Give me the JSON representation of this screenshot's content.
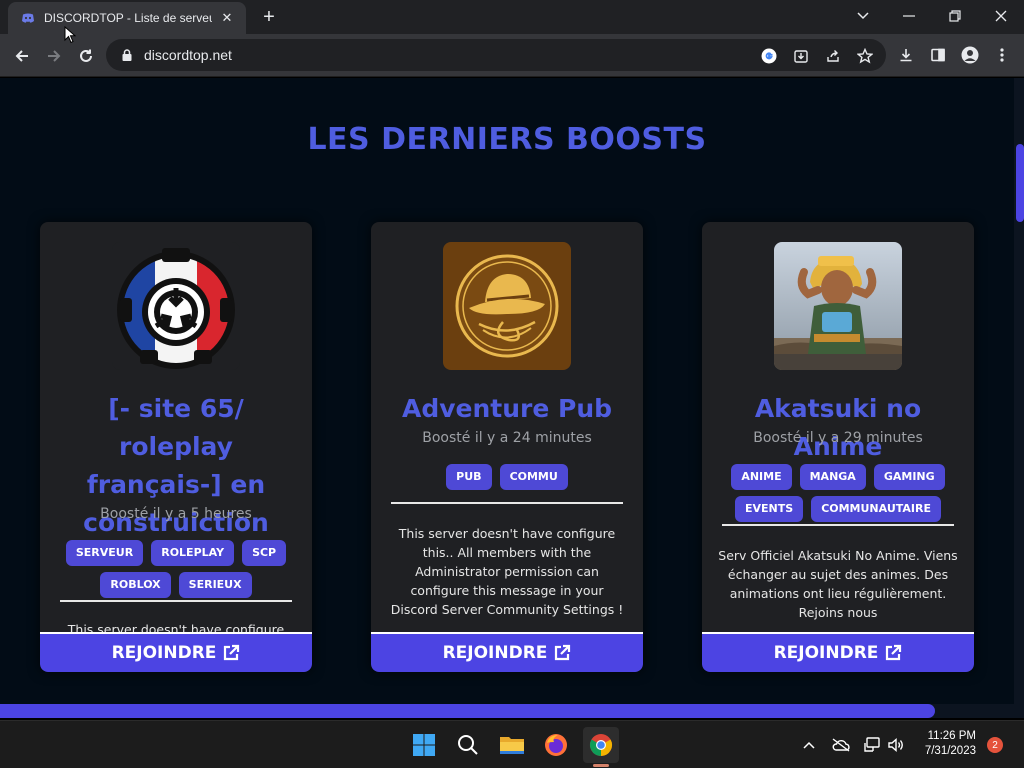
{
  "browser": {
    "tab_title": "DISCORDTOP - Liste de serveurs Discord",
    "url": "discordtop.net"
  },
  "page": {
    "heading": "LES DERNIERS BOOSTS",
    "cards": [
      {
        "name": "[- site 65/ roleplay français-] en construiction",
        "boosted": "Boosté il y a 5 heures",
        "tags": [
          "SERVEUR",
          "ROLEPLAY",
          "SCP",
          "ROBLOX",
          "SERIEUX"
        ],
        "description": "This server doesn't have configure this.. All members with the Administrator permission can configure this message in your",
        "join_label": "REJOINDRE"
      },
      {
        "name": "Adventure Pub",
        "boosted": "Boosté il y a 24 minutes",
        "tags": [
          "PUB",
          "COMMU"
        ],
        "description": "This server doesn't have configure this.. All members with the Administrator permission can configure this message in your Discord Server Community Settings !",
        "join_label": "REJOINDRE"
      },
      {
        "name": "Akatsuki no Anime",
        "boosted": "Boosté il y a 29 minutes",
        "tags": [
          "ANIME",
          "MANGA",
          "GAMING",
          "EVENTS",
          "COMMUNAUTAIRE"
        ],
        "description": "Serv Officiel Akatsuki No Anime. Viens échanger au sujet des animes. Des animations ont lieu régulièrement. Rejoins nous",
        "join_label": "REJOINDRE"
      }
    ]
  },
  "taskbar": {
    "time": "11:26 PM",
    "date": "7/31/2023",
    "notification_count": "2",
    "apps": [
      "windows-start",
      "search",
      "file-explorer",
      "firefox",
      "chrome"
    ]
  },
  "colors": {
    "accent": "#4f5de0",
    "button": "#4c44e3",
    "tag": "#4e49d6",
    "page_bg": "#020c16",
    "card_bg": "#1f2023"
  }
}
